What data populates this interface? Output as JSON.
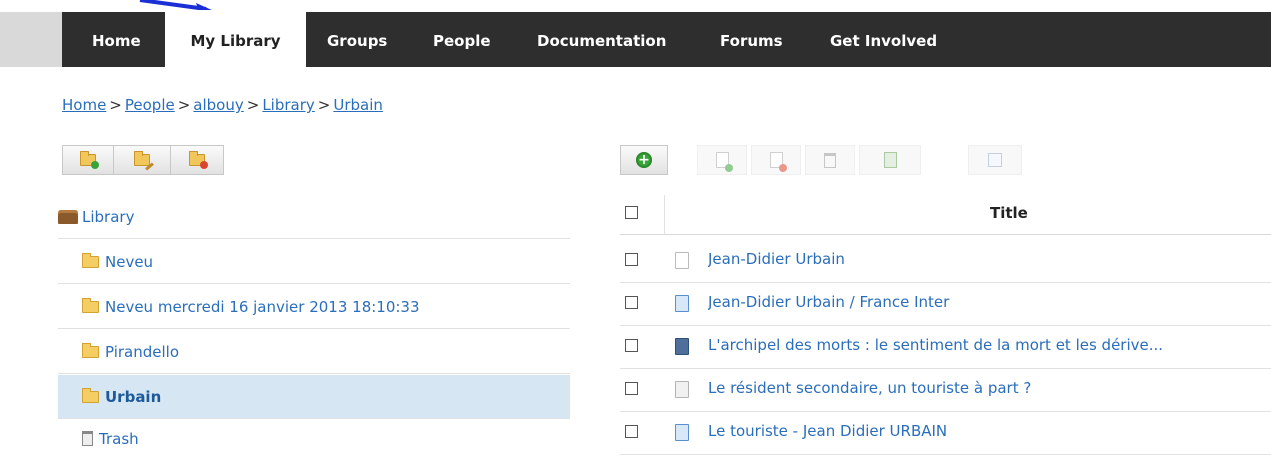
{
  "nav": {
    "tabs": [
      {
        "label": "Home"
      },
      {
        "label": "My Library"
      },
      {
        "label": "Groups"
      },
      {
        "label": "People"
      },
      {
        "label": "Documentation"
      },
      {
        "label": "Forums"
      },
      {
        "label": "Get Involved"
      }
    ],
    "active": "My Library"
  },
  "breadcrumb": {
    "items": [
      "Home",
      "People",
      "albouy",
      "Library",
      "Urbain"
    ],
    "separator": ">"
  },
  "left_toolbar": {
    "icons": [
      "new-folder-icon",
      "edit-folder-icon",
      "delete-folder-icon"
    ]
  },
  "right_toolbar": {
    "icons": [
      "add-item-icon",
      "add-to-collection-icon",
      "remove-from-collection-icon",
      "trash-icon",
      "restore-icon",
      "edit-icon"
    ]
  },
  "tree": {
    "root": "Library",
    "folders": [
      "Neveu",
      "Neveu mercredi 16 janvier 2013 18:10:33",
      "Pirandello",
      "Urbain"
    ],
    "selected": "Urbain",
    "trash": "Trash"
  },
  "table": {
    "header": {
      "title": "Title"
    },
    "rows": [
      {
        "title": "Jean-Didier Urbain",
        "icon": "blank-document-icon"
      },
      {
        "title": "Jean-Didier Urbain / France Inter",
        "icon": "audio-document-icon"
      },
      {
        "title": "L'archipel des morts : le sentiment de la mort et les dérive...",
        "icon": "book-icon"
      },
      {
        "title": "Le résident secondaire, un touriste à part ?",
        "icon": "article-icon"
      },
      {
        "title": "Le touriste - Jean Didier URBAIN",
        "icon": "audio-document-icon"
      }
    ]
  },
  "colors": {
    "nav_bg": "#2e2e2e",
    "link": "#2a6ebb",
    "selected_row": "#d6e6f3",
    "annotation_arrow": "#1a2fd6"
  }
}
